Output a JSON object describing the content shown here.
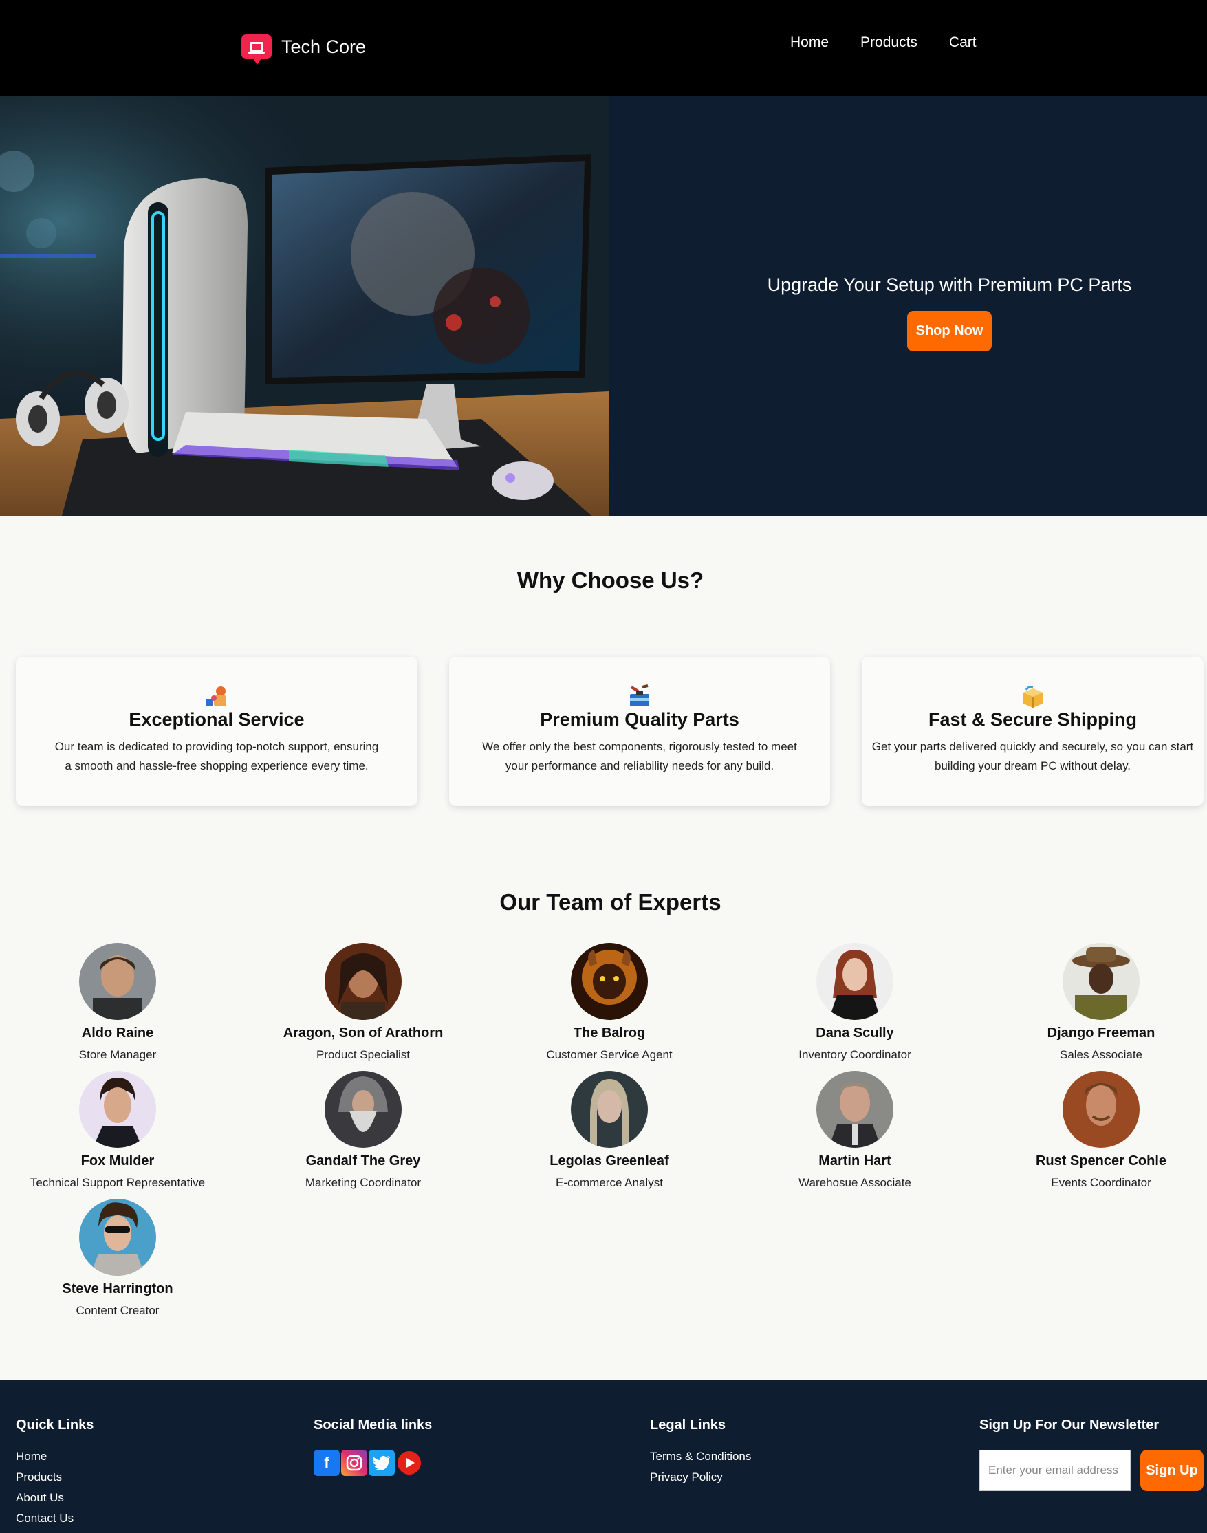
{
  "header": {
    "brand": "Tech Core",
    "nav": [
      "Home",
      "Products",
      "Cart"
    ]
  },
  "hero": {
    "title": "Upgrade Your Setup with Premium PC Parts",
    "cta": "Shop Now"
  },
  "why": {
    "title": "Why Choose Us?",
    "cards": [
      {
        "icon": "support-team-icon",
        "title": "Exceptional Service",
        "text": "Our team is dedicated to providing top-notch support, ensuring a smooth and hassle-free shopping experience every time."
      },
      {
        "icon": "toolbox-icon",
        "title": "Premium Quality Parts",
        "text": "We offer only the best components, rigorously tested to meet your performance and reliability needs for any build."
      },
      {
        "icon": "package-icon",
        "title": "Fast & Secure Shipping",
        "text": "Get your parts delivered quickly and securely, so you can start building your dream PC without delay."
      }
    ]
  },
  "team": {
    "title": "Our Team of Experts",
    "members": [
      {
        "name": "Aldo Raine",
        "role": "Store Manager"
      },
      {
        "name": "Aragon, Son of Arathorn",
        "role": "Product Specialist"
      },
      {
        "name": "The Balrog",
        "role": "Customer Service Agent"
      },
      {
        "name": "Dana Scully",
        "role": "Inventory Coordinator"
      },
      {
        "name": "Django Freeman",
        "role": "Sales Associate"
      },
      {
        "name": "Fox Mulder",
        "role": "Technical Support Representative"
      },
      {
        "name": "Gandalf The Grey",
        "role": "Marketing Coordinator"
      },
      {
        "name": "Legolas Greenleaf",
        "role": "E-commerce Analyst"
      },
      {
        "name": "Martin Hart",
        "role": "Warehosue Associate"
      },
      {
        "name": "Rust Spencer Cohle",
        "role": "Events Coordinator"
      },
      {
        "name": "Steve Harrington",
        "role": "Content Creator"
      }
    ]
  },
  "footer": {
    "quick": {
      "title": "Quick Links",
      "links": [
        "Home",
        "Products",
        "About Us",
        "Contact Us"
      ]
    },
    "social": {
      "title": "Social Media links",
      "icons": [
        "facebook-icon",
        "instagram-icon",
        "twitter-icon",
        "youtube-icon"
      ]
    },
    "legal": {
      "title": "Legal Links",
      "links": [
        "Terms & Conditions",
        "Privacy Policy"
      ]
    },
    "newsletter": {
      "title": "Sign Up For Our Newsletter",
      "placeholder": "Enter your email address here",
      "button": "Sign Up"
    }
  },
  "colors": {
    "accent": "#ff6a00",
    "brand": "#f2234c",
    "dark": "#0e1d30"
  }
}
